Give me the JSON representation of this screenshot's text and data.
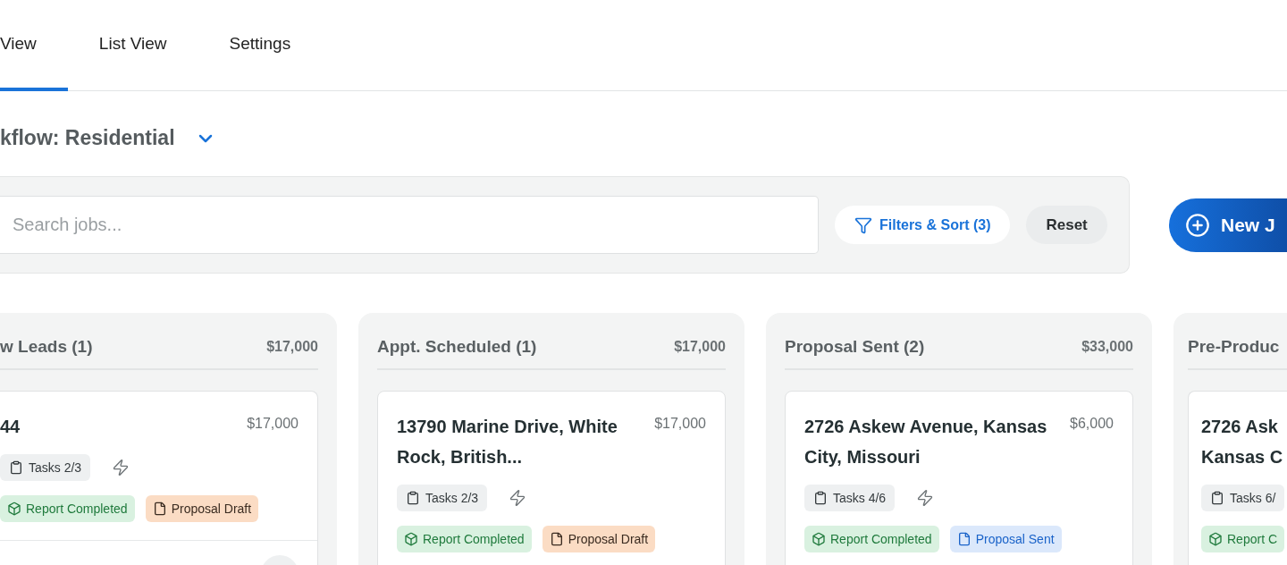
{
  "tabs": [
    {
      "label": "View",
      "selected": true
    },
    {
      "label": "List View",
      "selected": false
    },
    {
      "label": "Settings",
      "selected": false
    }
  ],
  "workflow": {
    "label": "kflow: Residential"
  },
  "search": {
    "placeholder": "Search jobs..."
  },
  "filters_button": {
    "label": "Filters & Sort (3)"
  },
  "reset_button": {
    "label": "Reset"
  },
  "new_button": {
    "label": "New J"
  },
  "columns": [
    {
      "title": "w Leads (1)",
      "total": "$17,000",
      "cards": [
        {
          "title": "44",
          "amount": "$17,000",
          "tasks": "Tasks 2/3",
          "tags": [
            {
              "kind": "report",
              "label": "Report Completed"
            },
            {
              "kind": "draft",
              "label": "Proposal Draft"
            }
          ]
        }
      ]
    },
    {
      "title": "Appt. Scheduled (1)",
      "total": "$17,000",
      "cards": [
        {
          "title": "13790 Marine Drive, White Rock, British...",
          "amount": "$17,000",
          "tasks": "Tasks 2/3",
          "tags": [
            {
              "kind": "report",
              "label": "Report Completed"
            },
            {
              "kind": "draft",
              "label": "Proposal Draft"
            }
          ]
        }
      ]
    },
    {
      "title": "Proposal Sent (2)",
      "total": "$33,000",
      "cards": [
        {
          "title": "2726 Askew Avenue, Kansas City, Missouri",
          "amount": "$6,000",
          "tasks": "Tasks 4/6",
          "tags": [
            {
              "kind": "report",
              "label": "Report Completed"
            },
            {
              "kind": "sent",
              "label": "Proposal Sent"
            }
          ]
        }
      ]
    },
    {
      "title": "Pre-Produc",
      "cards": [
        {
          "title": "2726 Ask Kansas C",
          "tasks": "Tasks 6/",
          "tags": [
            {
              "kind": "report",
              "label": "Report C"
            }
          ]
        }
      ]
    }
  ]
}
